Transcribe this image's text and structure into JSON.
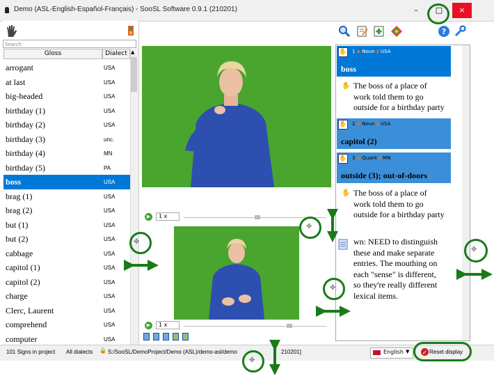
{
  "window": {
    "title": "Demo (ASL-English-Español-Français) - SooSL Software 0.9.1 (210201)",
    "minimize_label": "–",
    "maximize_label": "□",
    "close_label": "×"
  },
  "left_panel": {
    "search_placeholder": "Search",
    "columns": {
      "gloss": "Gloss",
      "dialect": "Dialect"
    },
    "rows": [
      {
        "gloss": "arrogant",
        "dialect": "USA"
      },
      {
        "gloss": "at last",
        "dialect": "USA"
      },
      {
        "gloss": "big-headed",
        "dialect": "USA"
      },
      {
        "gloss": "birthday (1)",
        "dialect": "USA"
      },
      {
        "gloss": "birthday (2)",
        "dialect": "USA"
      },
      {
        "gloss": "birthday (3)",
        "dialect": "unc."
      },
      {
        "gloss": "birthday (4)",
        "dialect": "MN"
      },
      {
        "gloss": "birthday (5)",
        "dialect": "PA"
      },
      {
        "gloss": "boss",
        "dialect": "USA",
        "selected": true
      },
      {
        "gloss": "brag (1)",
        "dialect": "USA"
      },
      {
        "gloss": "brag (2)",
        "dialect": "USA"
      },
      {
        "gloss": "but (1)",
        "dialect": "USA"
      },
      {
        "gloss": "but (2)",
        "dialect": "USA"
      },
      {
        "gloss": "cabbage",
        "dialect": "USA"
      },
      {
        "gloss": "capitol (1)",
        "dialect": "USA"
      },
      {
        "gloss": "capitol (2)",
        "dialect": "USA"
      },
      {
        "gloss": "charge",
        "dialect": "USA"
      },
      {
        "gloss": "Clerc, Laurent",
        "dialect": "USA"
      },
      {
        "gloss": "comprehend",
        "dialect": "USA"
      },
      {
        "gloss": "computer",
        "dialect": "USA"
      }
    ]
  },
  "video": {
    "speed1": "1 x",
    "speed2": "1 x"
  },
  "senses": [
    {
      "num": "1",
      "pos": "Noun",
      "dialect": "USA",
      "title": "boss",
      "sentence": [
        "The boss of a place of",
        "work told them to go",
        "outside for a birthday party"
      ]
    },
    {
      "num": "2",
      "pos": "Noun",
      "dialect": "USA",
      "title": "capitol (2)"
    },
    {
      "num": "3",
      "pos": "Quant",
      "dialect": "MN",
      "title": "outside (3); out-of-doors",
      "sentence": [
        "The boss of a place of",
        "work told them to go",
        "outside for a birthday party"
      ]
    }
  ],
  "note": {
    "lines": [
      "wn: NEED to distinguish",
      "these and make separate",
      "entries. The mouthing on",
      "each \"sense\" is different,",
      "so they're really different",
      "lexical items."
    ]
  },
  "statusbar": {
    "count": "101 Signs in project",
    "dialects": "All dialects",
    "path": "S:/SooSL/DemoProject/Demo (ASL)/demo-asl/demo",
    "path_suffix": "210201]",
    "language": "English",
    "reset": "Reset display"
  },
  "colors": {
    "selection": "#0078d7",
    "sense_header": "#3b8fd9",
    "video_bg": "#49a52e",
    "annotation": "#1a7a1a"
  }
}
